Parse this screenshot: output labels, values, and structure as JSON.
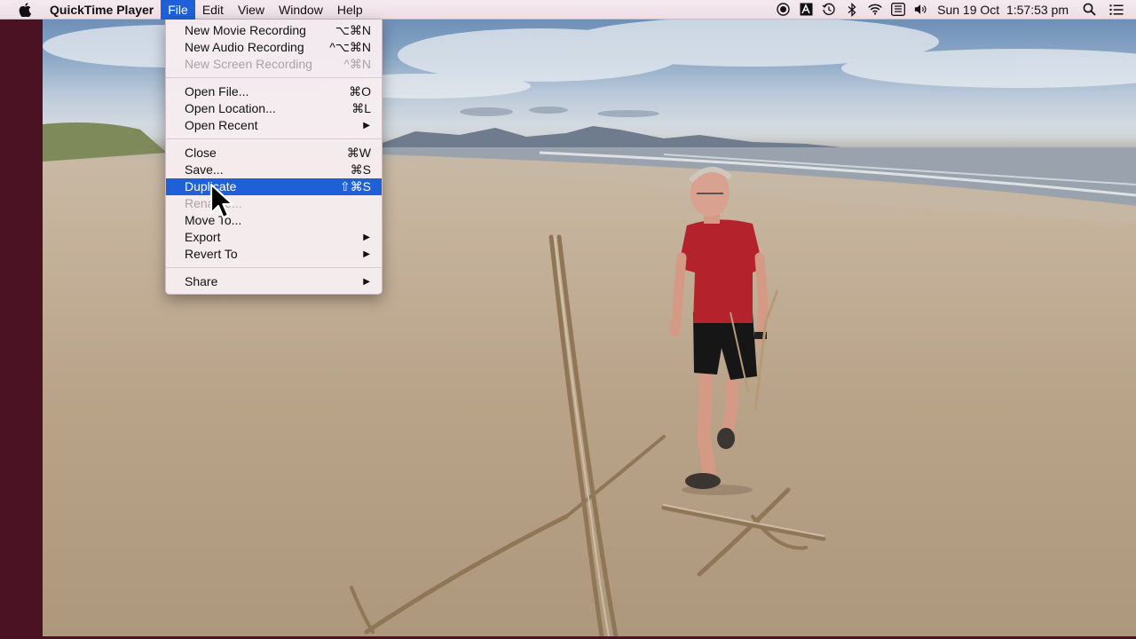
{
  "menubar": {
    "app_name": "QuickTime Player",
    "items": [
      {
        "label": "File",
        "active": true
      },
      {
        "label": "Edit"
      },
      {
        "label": "View"
      },
      {
        "label": "Window"
      },
      {
        "label": "Help"
      }
    ],
    "status": {
      "datetime": "Sun 19 Oct  1:57:53 pm",
      "icons": [
        "record-icon",
        "text-input-icon",
        "time-machine-icon",
        "bluetooth-icon",
        "wifi-icon",
        "keyboard-icon",
        "volume-icon",
        "spotlight-icon",
        "notification-center-icon"
      ]
    }
  },
  "file_menu": {
    "groups": [
      [
        {
          "label": "New Movie Recording",
          "shortcut": "⌥⌘N"
        },
        {
          "label": "New Audio Recording",
          "shortcut": "^⌥⌘N"
        },
        {
          "label": "New Screen Recording",
          "shortcut": "^⌘N",
          "disabled": true
        }
      ],
      [
        {
          "label": "Open File...",
          "shortcut": "⌘O"
        },
        {
          "label": "Open Location...",
          "shortcut": "⌘L"
        },
        {
          "label": "Open Recent",
          "submenu": true
        }
      ],
      [
        {
          "label": "Close",
          "shortcut": "⌘W"
        },
        {
          "label": "Save...",
          "shortcut": "⌘S"
        },
        {
          "label": "Duplicate",
          "shortcut": "⇧⌘S",
          "highlighted": true
        },
        {
          "label": "Rename...",
          "disabled": true
        },
        {
          "label": "Move To...",
          "disabled": false
        },
        {
          "label": "Export",
          "submenu": true
        },
        {
          "label": "Revert To",
          "submenu": true
        }
      ],
      [
        {
          "label": "Share",
          "submenu": true
        }
      ]
    ]
  },
  "colors": {
    "highlight": "#1f5fd8",
    "desktop": "#4a1222",
    "menubar": "#f4e9ee"
  }
}
